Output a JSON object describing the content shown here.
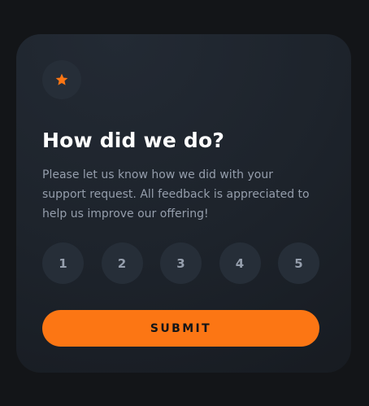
{
  "card": {
    "icon": "star-icon",
    "title": "How did we do?",
    "description": "Please let us know how we did with your support request. All feedback is appreciated to help us improve our offering!",
    "ratings": [
      "1",
      "2",
      "3",
      "4",
      "5"
    ],
    "submit_label": "SUBMIT"
  },
  "colors": {
    "background": "#131518",
    "card": "#1d232b",
    "circle": "#262e38",
    "accent": "#fc7614",
    "text_primary": "#ffffff",
    "text_secondary": "#959eac"
  }
}
